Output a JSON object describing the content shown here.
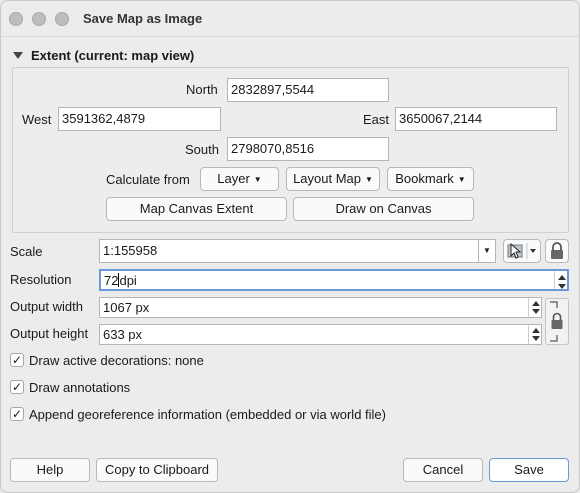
{
  "window": {
    "title": "Save Map as Image"
  },
  "extent": {
    "header": "Extent (current: map view)",
    "north_label": "North",
    "north_value": "2832897,5544",
    "west_label": "West",
    "west_value": "3591362,4879",
    "east_label": "East",
    "east_value": "3650067,2144",
    "south_label": "South",
    "south_value": "2798070,8516",
    "calculate_label": "Calculate from",
    "layer_button": "Layer",
    "layout_map_button": "Layout Map",
    "bookmark_button": "Bookmark",
    "map_canvas_extent_button": "Map Canvas Extent",
    "draw_on_canvas_button": "Draw on Canvas"
  },
  "settings": {
    "scale_label": "Scale",
    "scale_value": "1:155958",
    "resolution_label": "Resolution",
    "resolution_value": "72",
    "resolution_unit": "dpi",
    "width_label": "Output width",
    "width_value": "1067 px",
    "height_label": "Output height",
    "height_value": "633 px"
  },
  "options": {
    "decorations": {
      "label": "Draw active decorations: none",
      "checked": true
    },
    "annotations": {
      "label": "Draw annotations",
      "checked": true
    },
    "georeference": {
      "label": "Append georeference information (embedded or via world file)",
      "checked": true
    }
  },
  "footer": {
    "help": "Help",
    "copy": "Copy to Clipboard",
    "cancel": "Cancel",
    "save": "Save"
  },
  "icons": {
    "check": "✓",
    "caret": "▾"
  }
}
